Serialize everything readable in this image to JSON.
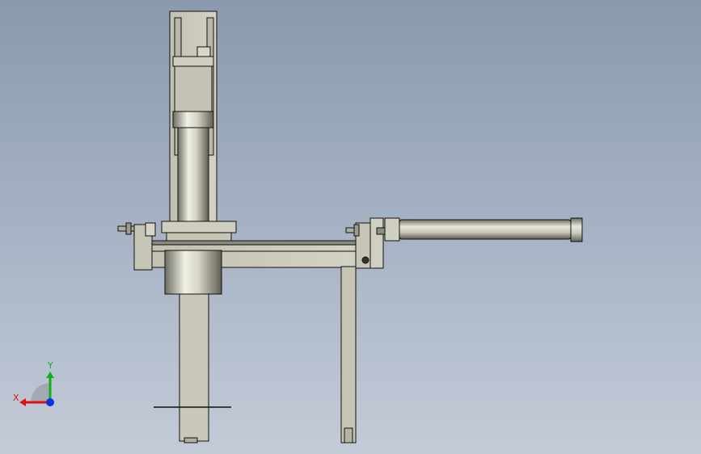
{
  "viewport": {
    "background_top": "#8a99ad",
    "background_bottom": "#c4cbd8",
    "part_fill": "#c9c8b8",
    "part_shadow": "#a8a795",
    "edge_color": "#111111"
  },
  "triad": {
    "x_label": "X",
    "y_label": "Y",
    "x_color": "#e01010",
    "y_color": "#10b020",
    "z_color": "#1030e0"
  }
}
